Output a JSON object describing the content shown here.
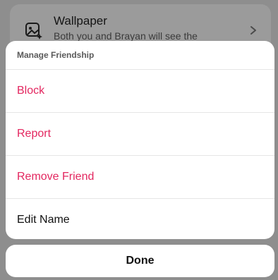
{
  "background": {
    "wallpaper_title": "Wallpaper",
    "wallpaper_subtitle": "Both you and Brayan will see the",
    "icon": "wallpaper-icon"
  },
  "sheet": {
    "header": "Manage Friendship",
    "items": [
      {
        "label": "Block",
        "style": "danger"
      },
      {
        "label": "Report",
        "style": "danger"
      },
      {
        "label": "Remove Friend",
        "style": "danger"
      },
      {
        "label": "Edit Name",
        "style": "normal"
      }
    ]
  },
  "done_label": "Done",
  "colors": {
    "danger": "#e3265f",
    "text": "#111111",
    "overlay": "#8e8e8e"
  }
}
